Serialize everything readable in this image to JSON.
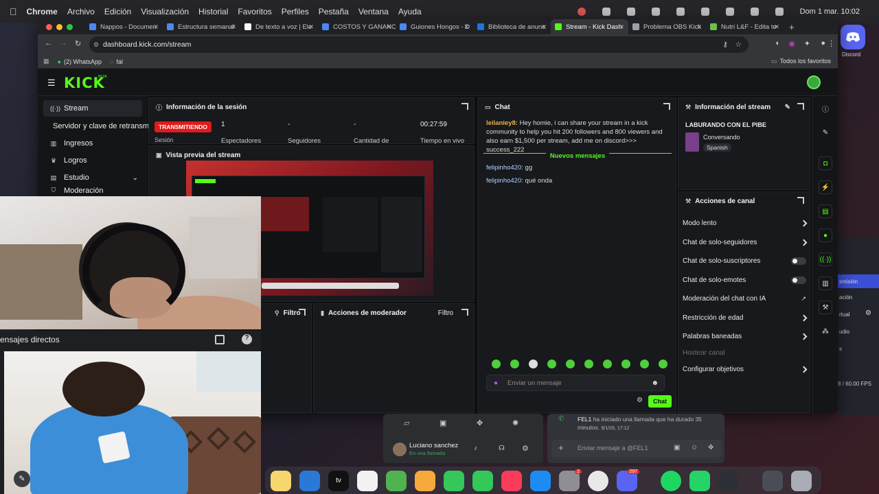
{
  "menubar": {
    "app": "Chrome",
    "items": [
      "Archivo",
      "Edición",
      "Visualización",
      "Historial",
      "Favoritos",
      "Perfiles",
      "Pestaña",
      "Ventana",
      "Ayuda"
    ],
    "datetime": "Dom 1 mar.  10:02"
  },
  "browser": {
    "tabs": [
      {
        "label": "Nappos - Documen"
      },
      {
        "label": "Estructura semanal"
      },
      {
        "label": "De texto a voz | Ele"
      },
      {
        "label": "COSTOS Y GANANC"
      },
      {
        "label": "Guiones Hongos - D"
      },
      {
        "label": "Biblioteca de anunc"
      },
      {
        "label": "Stream - Kick Dash"
      },
      {
        "label": "Problema OBS Kick"
      },
      {
        "label": "Nutri L&F - Edita te"
      }
    ],
    "active_tab": "Stream - Kick Dash",
    "url": "dashboard.kick.com/stream",
    "bookmarks": [
      "(2) WhatsApp",
      "fal"
    ],
    "all_bookmarks": "Todos los favoritos"
  },
  "kick": {
    "logo": "KICK",
    "logo_sup": "BETA",
    "sidebar": [
      {
        "label": "Stream",
        "icon": "stream-icon"
      },
      {
        "label": "Servidor y clave de retransm",
        "icon": ""
      },
      {
        "label": "Ingresos",
        "icon": "chart-icon"
      },
      {
        "label": "Logros",
        "icon": "trophy-icon"
      },
      {
        "label": "Estudio",
        "icon": "studio-icon"
      },
      {
        "label": "Moderación",
        "icon": "shield-icon"
      }
    ],
    "session": {
      "title": "Información de la sesión",
      "status": "TRANSMITIENDO",
      "session_label": "Sesión",
      "viewers_value": "1",
      "viewers_label": "Espectadores",
      "followers_value": "-",
      "followers_label": "Seguidores",
      "amount_value": "-",
      "amount_label": "Cantidad de",
      "live_time_value": "00:27:59",
      "live_time_label": "Tiempo en vivo"
    },
    "preview": {
      "title": "Vista previa del stream"
    },
    "chat_filter": "Filtro",
    "mod_actions": {
      "title": "Acciones de moderador",
      "filter": "Filtro"
    },
    "chat": {
      "title": "Chat",
      "messages_before": [
        {
          "user": "leilaniey8:",
          "text": "Hey homie, i can share your stream in a kick community to help you hit 200 followers and 800 viewers and also earn $1,500 per stream, add me on discord>>> success_222"
        }
      ],
      "new_messages_label": "Nuevos mensajes",
      "messages_after": [
        {
          "user": "felipinho420:",
          "text": "gg"
        },
        {
          "user": "felipinho420:",
          "text": "qué onda"
        }
      ],
      "input_placeholder": "Enviar un mensaje",
      "send_label": "Chat"
    },
    "stream_info": {
      "title": "Información del stream",
      "stream_title": "LABURANDO CON EL PIBE",
      "category": "Conversando",
      "language": "Spanish"
    },
    "channel_actions": {
      "title": "Acciones de canal",
      "rows": [
        {
          "label": "Modo lento",
          "control": "chevron"
        },
        {
          "label": "Chat de solo-seguidores",
          "control": "chevron"
        },
        {
          "label": "Chat de solo-suscriptores",
          "control": "toggle"
        },
        {
          "label": "Chat de solo-emotes",
          "control": "toggle"
        },
        {
          "label": "Moderación del chat con IA",
          "control": "chart"
        },
        {
          "label": "Restricción de edad",
          "control": "chevron"
        },
        {
          "label": "Palabras baneadas",
          "control": "chevron"
        },
        {
          "label": "Hostear canal",
          "control": "disabled"
        },
        {
          "label": "Configurar objetivos",
          "control": "chevron"
        }
      ]
    }
  },
  "discord": {
    "dock_label": "Discord",
    "dm_title": "ensajes directos",
    "call_user": "Luciano sanchez",
    "call_status": "En una llamada",
    "log_user": "FEL1",
    "log_text": "ha iniciado una llamada que ha durado 35 minutos.",
    "log_time": "9/1/26, 17:12",
    "input_placeholder": "Enviar mensaje a @FEL1"
  },
  "obs": {
    "rows": [
      "smisión",
      "ación",
      "rtual",
      "udio",
      "s"
    ],
    "fps": "8 / 60.00 FPS"
  },
  "dock": {
    "badges": {
      "settings": "2",
      "discord": "297"
    }
  },
  "colors": {
    "kick_green": "#53fc18",
    "live_red": "#e01b1b",
    "panel_bg": "#17191c"
  }
}
